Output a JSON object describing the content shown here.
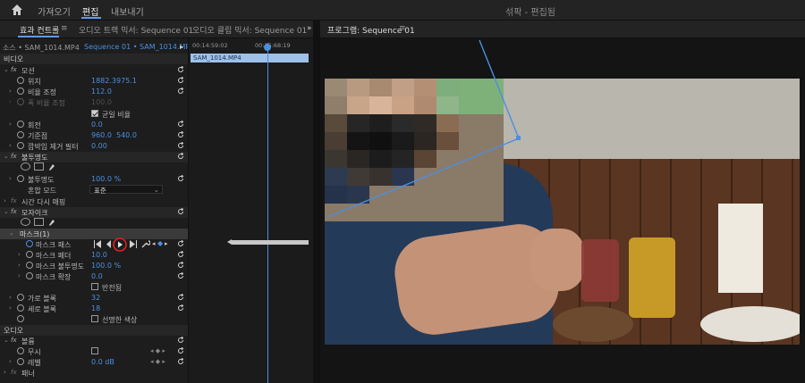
{
  "topbar": {
    "tabs": [
      "가져오기",
      "편집",
      "내보내기"
    ],
    "active_tab": "편집",
    "title": "섞팍 - 편집됨"
  },
  "left_tabs": {
    "effect_controls": "효과 컨트롤",
    "menu_icon": "≡",
    "audio_mixer": "오디오 트랙 믹서: Sequence 01"
  },
  "mid_tabs": {
    "clip_mixer": "오디오 클립 믹서: Sequence 01",
    "more": "»"
  },
  "program_tab": {
    "label": "프로그램: Sequence 01",
    "menu_icon": "≡"
  },
  "source": {
    "left": "소스 • SAM_1014.MP4",
    "right": "Sequence 01 • SAM_1014.MP4",
    "arrow": "▸"
  },
  "effects": {
    "video": "비디오",
    "motion": "모션",
    "position_label": "위치",
    "position_x": "1882.3",
    "position_y": "975.1",
    "scale_label": "비율 조정",
    "scale": "112.0",
    "scale_width_label": "폭 비율 조정",
    "scale_width": "100.0",
    "uniform_label": "균일 비율",
    "rotation_label": "회전",
    "rotation": "0.0",
    "anchor_label": "기준점",
    "anchor_x": "960.0",
    "anchor_y": "540.0",
    "flicker_label": "깜박임 제거 필터",
    "flicker": "0.00",
    "opacity_section": "불투명도",
    "opacity_label": "불투명도",
    "opacity": "100.0 %",
    "blend_label": "혼합 모드",
    "blend": "표준",
    "time_remap": "시간 다시 매핑",
    "mosaic_section": "모자이크",
    "mask_label": "마스크(1)",
    "mask_path_label": "마스크 패스",
    "mask_feather_label": "마스크 페더",
    "mask_feather": "10.0",
    "mask_opacity_label": "마스크 불투명도",
    "mask_opacity": "100.0 %",
    "mask_expansion_label": "마스크 확장",
    "mask_expansion": "0.0",
    "inverted_label": "반전됨",
    "h_blocks_label": "가로 블록",
    "h_blocks": "32",
    "v_blocks_label": "세로 블록",
    "v_blocks": "18",
    "sharp_colors_label": "선명한 색상",
    "audio": "오디오",
    "volume_section": "볼륨",
    "bypass_label": "무시",
    "level_label": "레벨",
    "level": "0.0 dB",
    "panner_label": "패너"
  },
  "timeline": {
    "timecode_left": "00:14:59:02",
    "timecode_right": "00:15:68:19",
    "clip_name": "SAM_1014.MP4"
  },
  "colors": {
    "accent": "#4a8fe0",
    "highlight_ring": "#e02020",
    "mask_line": "#4a8fe0"
  }
}
